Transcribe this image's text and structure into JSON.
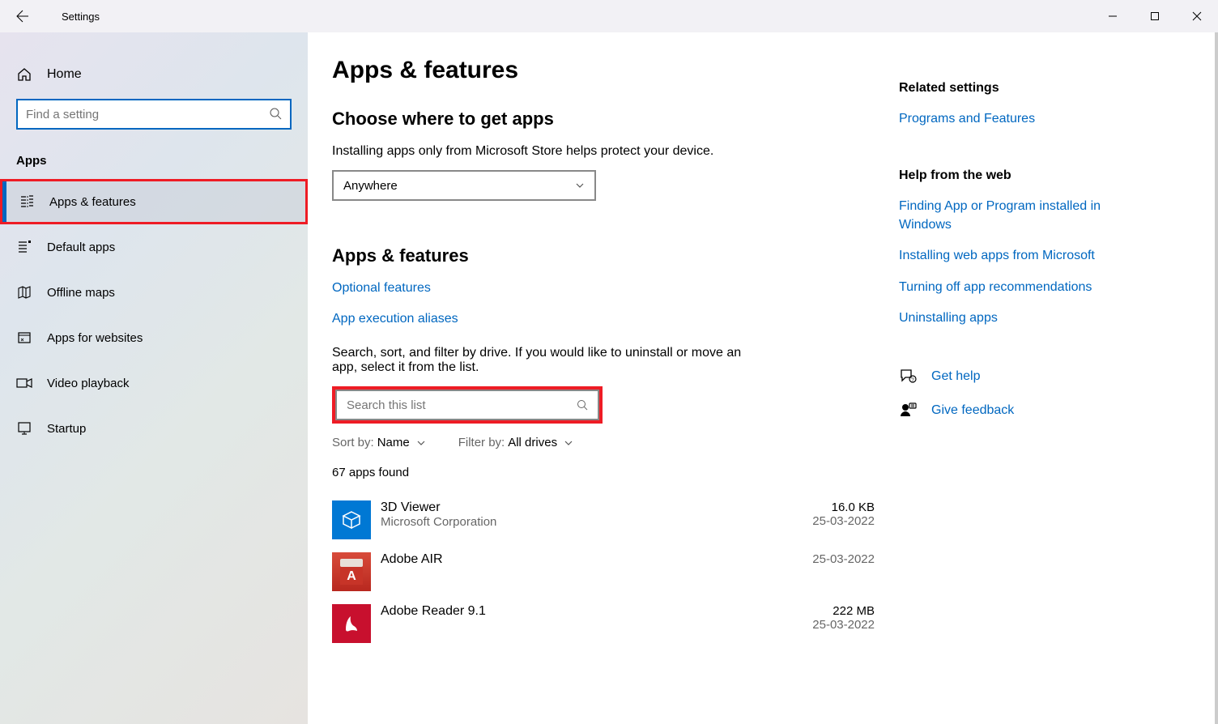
{
  "titlebar": {
    "title": "Settings"
  },
  "sidebar": {
    "home": "Home",
    "search_placeholder": "Find a setting",
    "section": "Apps",
    "items": [
      {
        "label": "Apps & features"
      },
      {
        "label": "Default apps"
      },
      {
        "label": "Offline maps"
      },
      {
        "label": "Apps for websites"
      },
      {
        "label": "Video playback"
      },
      {
        "label": "Startup"
      }
    ]
  },
  "main": {
    "h1": "Apps & features",
    "h2a": "Choose where to get apps",
    "pa": "Installing apps only from Microsoft Store helps protect your device.",
    "dropdown": "Anywhere",
    "h2b": "Apps & features",
    "link_optional": "Optional features",
    "link_aliases": "App execution aliases",
    "pb": "Search, sort, and filter by drive. If you would like to uninstall or move an app, select it from the list.",
    "search_placeholder": "Search this list",
    "sort_label": "Sort by:",
    "sort_value": "Name",
    "filter_label": "Filter by:",
    "filter_value": "All drives",
    "count": "67 apps found",
    "apps": [
      {
        "name": "3D Viewer",
        "publisher": "Microsoft Corporation",
        "size": "16.0 KB",
        "date": "25-03-2022"
      },
      {
        "name": "Adobe AIR",
        "publisher": "",
        "size": "",
        "date": "25-03-2022"
      },
      {
        "name": "Adobe Reader 9.1",
        "publisher": "",
        "size": "222 MB",
        "date": "25-03-2022"
      }
    ]
  },
  "right": {
    "related_h": "Related settings",
    "related_link": "Programs and Features",
    "help_h": "Help from the web",
    "help_links": [
      "Finding App or Program installed in Windows",
      "Installing web apps from Microsoft",
      "Turning off app recommendations",
      "Uninstalling apps"
    ],
    "get_help": "Get help",
    "feedback": "Give feedback"
  }
}
